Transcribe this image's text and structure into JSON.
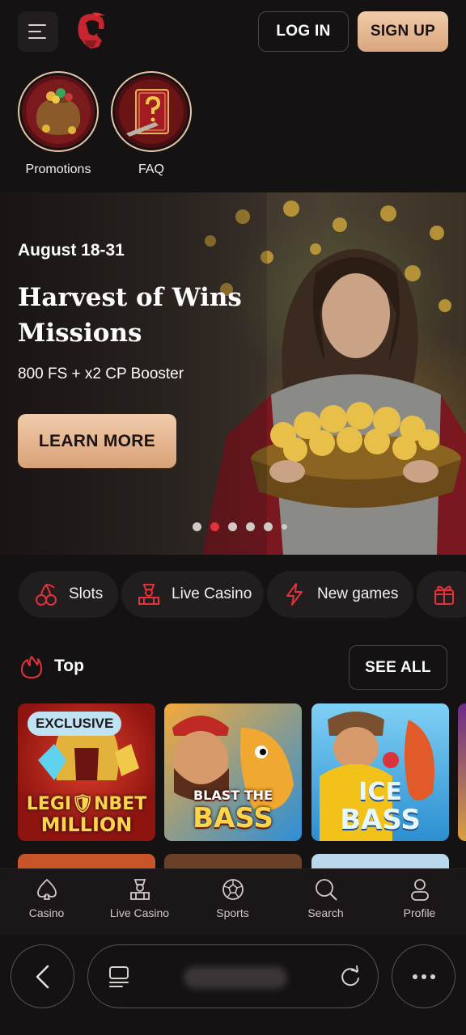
{
  "header": {
    "login_label": "LOG IN",
    "signup_label": "SIGN UP"
  },
  "stories": [
    {
      "label": "Promotions"
    },
    {
      "label": "FAQ"
    }
  ],
  "banner": {
    "date": "August 18-31",
    "title": "Harvest of Wins Missions",
    "subtitle": "800 FS + x2 CP Booster",
    "cta_label": "LEARN MORE",
    "carousel": {
      "total": 6,
      "active_index": 1
    }
  },
  "categories": [
    {
      "label": "Slots",
      "icon": "cherry-icon"
    },
    {
      "label": "Live Casino",
      "icon": "dealer-icon"
    },
    {
      "label": "New games",
      "icon": "lightning-icon"
    },
    {
      "label": "",
      "icon": "gift-icon"
    }
  ],
  "top_section": {
    "title": "Top",
    "see_all_label": "SEE ALL"
  },
  "games": [
    {
      "badge": "EXCLUSIVE",
      "title_line1": "LEGI🛡NBET",
      "title_line2": "MILLION"
    },
    {
      "title_line1": "BLAST THE",
      "title_line2": "BASS"
    },
    {
      "title_line1": "ICE",
      "title_line2": "BASS"
    }
  ],
  "bottom_nav": [
    {
      "label": "Casino",
      "icon": "spade-icon"
    },
    {
      "label": "Live Casino",
      "icon": "dealer-icon"
    },
    {
      "label": "Sports",
      "icon": "soccer-ball-icon"
    },
    {
      "label": "Search",
      "icon": "search-icon"
    },
    {
      "label": "Profile",
      "icon": "profile-icon"
    }
  ],
  "colors": {
    "background": "#151213",
    "accent_gold": "#e9c4a4",
    "accent_red": "#e0333b",
    "card": "#221d1e"
  }
}
